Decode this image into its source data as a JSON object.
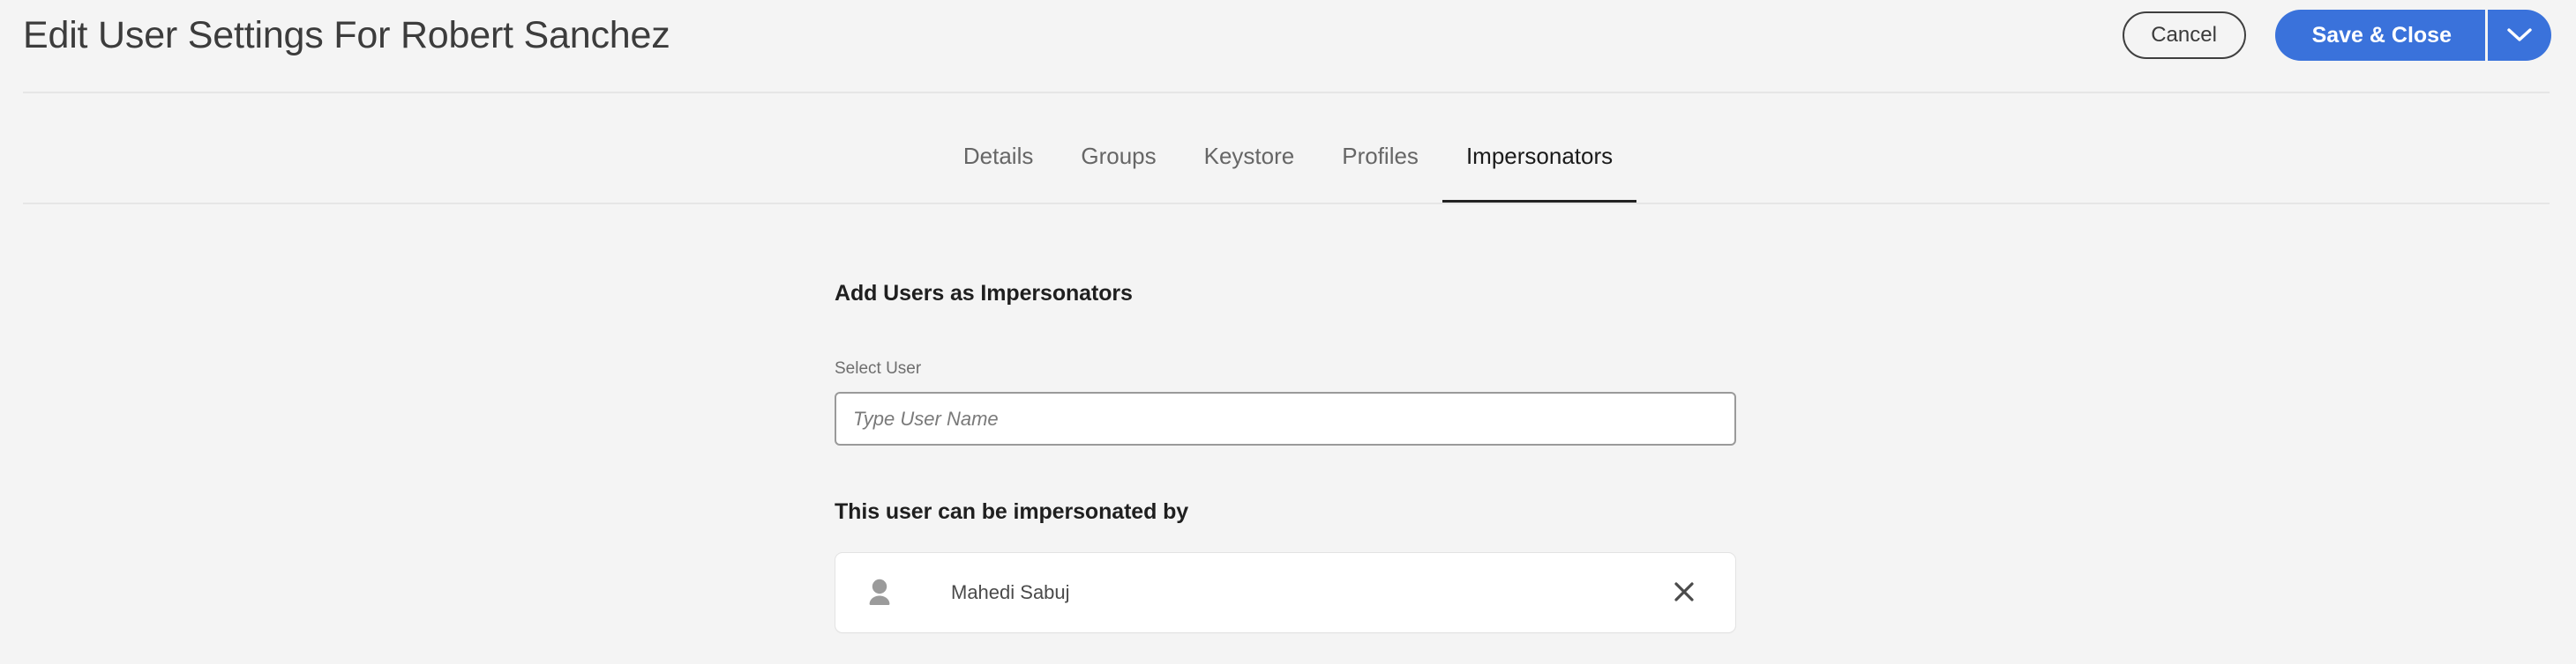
{
  "header": {
    "title": "Edit User Settings For Robert Sanchez",
    "cancel_label": "Cancel",
    "save_label": "Save & Close",
    "dropdown_icon": "chevron-down-icon",
    "accent_color": "#3a72db",
    "title_color": "#3c3c3c"
  },
  "tabs": [
    {
      "label": "Details",
      "active": false
    },
    {
      "label": "Groups",
      "active": false
    },
    {
      "label": "Keystore",
      "active": false
    },
    {
      "label": "Profiles",
      "active": false
    },
    {
      "label": "Impersonators",
      "active": true
    }
  ],
  "main": {
    "add_heading": "Add Users as Impersonators",
    "select_user_label": "Select User",
    "select_user_value": "",
    "select_user_placeholder": "Type User Name",
    "impersonated_by_heading": "This user can be impersonated by",
    "impersonators": [
      {
        "name": "Mahedi Sabuj",
        "avatar_icon": "user-avatar-icon",
        "remove_icon": "close-icon"
      }
    ]
  }
}
